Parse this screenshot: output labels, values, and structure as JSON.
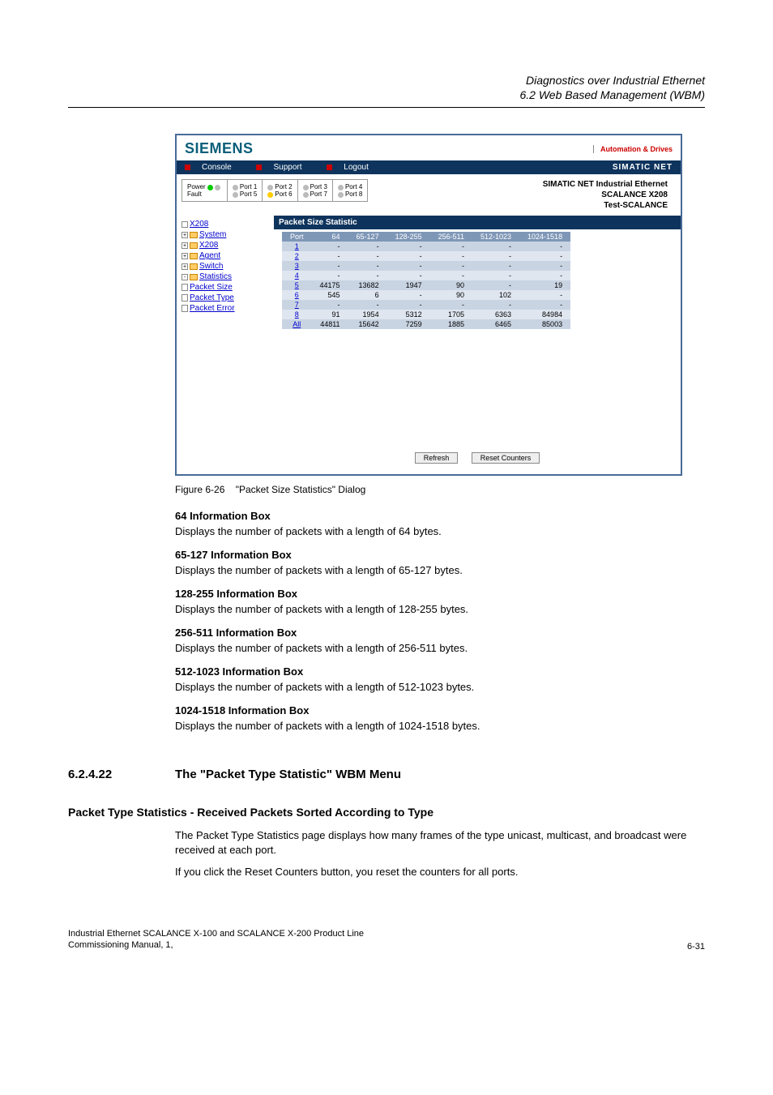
{
  "header": {
    "line1": "Diagnostics over Industrial Ethernet",
    "line2": "6.2 Web Based Management (WBM)"
  },
  "screenshot": {
    "brand": "SIEMENS",
    "brand_tag": "Automation & Drives",
    "menubar": {
      "console": "Console",
      "support": "Support",
      "logout": "Logout",
      "right": "SIMATIC NET"
    },
    "info_right": {
      "line1": "SIMATIC NET Industrial Ethernet",
      "line2": "SCALANCE X208",
      "line3": "Test-SCALANCE"
    },
    "status_panel": {
      "col0_l1": "Power",
      "col0_l2": "Fault",
      "ports": [
        "Port 1",
        "Port 2",
        "Port 3",
        "Port 4",
        "Port 5",
        "Port 6",
        "Port 7",
        "Port 8"
      ]
    },
    "tree": {
      "root": "X208",
      "items": [
        "System",
        "X208",
        "Agent",
        "Switch",
        "Statistics"
      ],
      "sub": [
        "Packet Size",
        "Packet Type",
        "Packet Error"
      ]
    },
    "panel_title": "Packet Size Statistic",
    "table": {
      "headers": [
        "Port",
        "64",
        "65-127",
        "128-255",
        "256-511",
        "512-1023",
        "1024-1518"
      ],
      "rows": [
        {
          "port": "1",
          "v": [
            "-",
            "-",
            "-",
            "-",
            "-",
            "-"
          ]
        },
        {
          "port": "2",
          "v": [
            "-",
            "-",
            "-",
            "-",
            "-",
            "-"
          ]
        },
        {
          "port": "3",
          "v": [
            "-",
            "-",
            "-",
            "-",
            "-",
            "-"
          ]
        },
        {
          "port": "4",
          "v": [
            "-",
            "-",
            "-",
            "-",
            "-",
            "-"
          ]
        },
        {
          "port": "5",
          "v": [
            "44175",
            "13682",
            "1947",
            "90",
            "-",
            "19"
          ]
        },
        {
          "port": "6",
          "v": [
            "545",
            "6",
            "-",
            "90",
            "102",
            "-"
          ]
        },
        {
          "port": "7",
          "v": [
            "-",
            "-",
            "-",
            "-",
            "-",
            "-"
          ]
        },
        {
          "port": "8",
          "v": [
            "91",
            "1954",
            "5312",
            "1705",
            "6363",
            "84984"
          ]
        },
        {
          "port": "All",
          "v": [
            "44811",
            "15642",
            "7259",
            "1885",
            "6465",
            "85003"
          ]
        }
      ]
    },
    "buttons": {
      "refresh": "Refresh",
      "reset": "Reset Counters"
    }
  },
  "caption": {
    "fig": "Figure 6-26",
    "text": "\"Packet Size Statistics\" Dialog"
  },
  "boxes": [
    {
      "title": "64 Information Box",
      "text": "Displays the number of packets with a length of 64 bytes."
    },
    {
      "title": "65-127 Information Box",
      "text": "Displays the number of packets with a length of 65-127 bytes."
    },
    {
      "title": "128-255 Information Box",
      "text": "Displays the number of packets with a length of 128-255 bytes."
    },
    {
      "title": "256-511 Information Box",
      "text": "Displays the number of packets with a length of 256-511 bytes."
    },
    {
      "title": "512-1023 Information Box",
      "text": "Displays the number of packets with a length of 512-1023 bytes."
    },
    {
      "title": "1024-1518 Information Box",
      "text": "Displays the number of packets with a length of 1024-1518 bytes."
    }
  ],
  "section": {
    "num": "6.2.4.22",
    "title": "The \"Packet Type Statistic\" WBM Menu"
  },
  "sub": {
    "title": "Packet Type Statistics - Received Packets Sorted According to Type",
    "p1": "The Packet Type Statistics page displays how many frames of the type unicast, multicast, and broadcast were received at each port.",
    "p2": "If you click the Reset Counters button, you reset the counters for all ports."
  },
  "footer": {
    "l1": "Industrial Ethernet SCALANCE X-100 and SCALANCE X-200 Product Line",
    "l2": "Commissioning Manual, 1,",
    "page": "6-31"
  }
}
